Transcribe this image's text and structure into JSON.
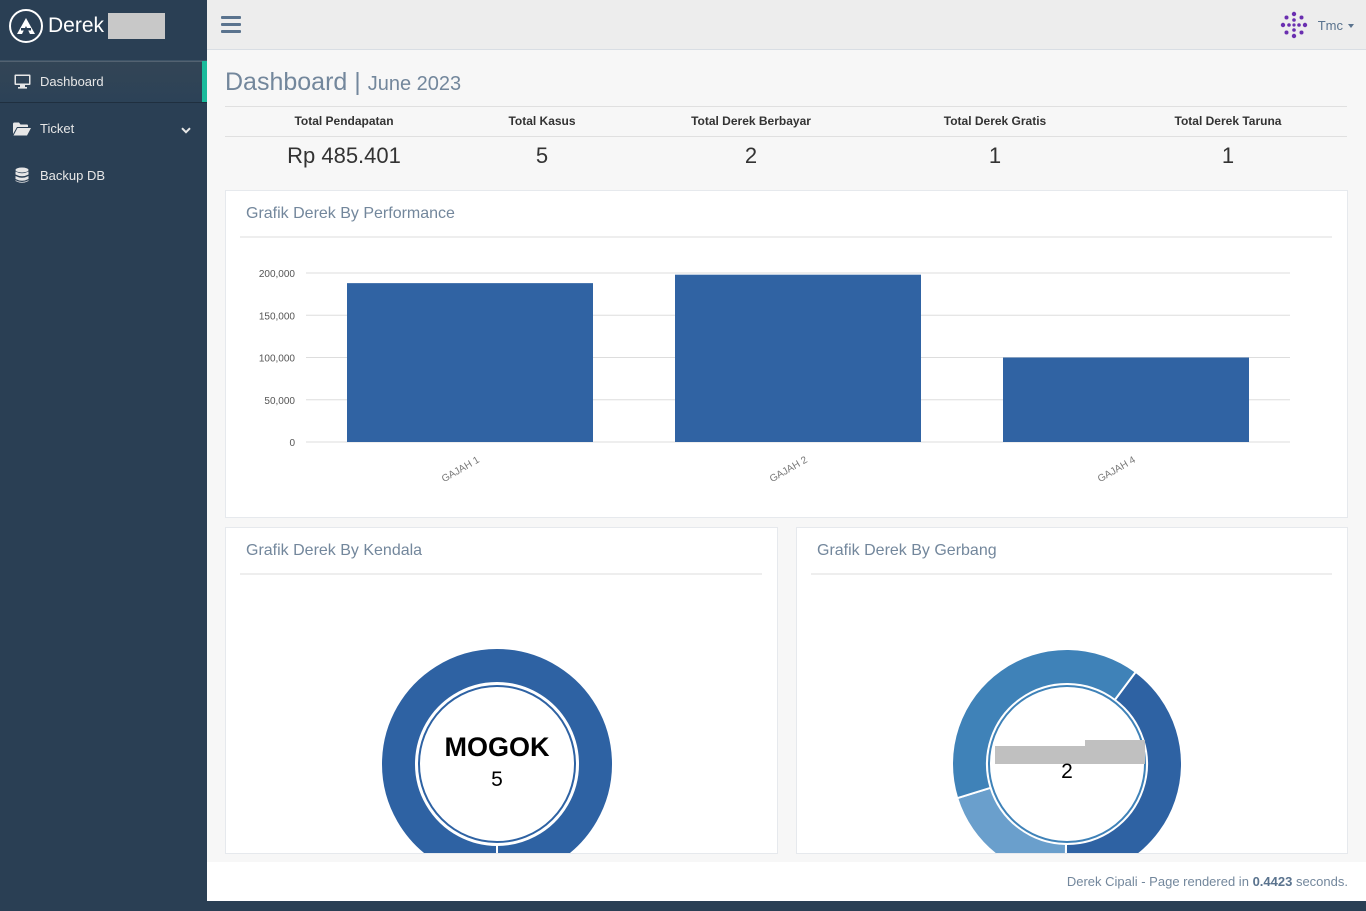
{
  "brand": {
    "title": "Derek"
  },
  "sidebar": {
    "items": [
      {
        "label": "Dashboard",
        "icon": "monitor-icon"
      },
      {
        "label": "Ticket",
        "icon": "folder-open-icon"
      },
      {
        "label": "Backup DB",
        "icon": "database-icon"
      }
    ]
  },
  "topbar": {
    "user_name": "Tmc"
  },
  "page": {
    "title": "Dashboard",
    "separator": "|",
    "subtitle": "June 2023"
  },
  "stats": [
    {
      "label": "Total Pendapatan",
      "value": "Rp 485.401"
    },
    {
      "label": "Total Kasus",
      "value": "5"
    },
    {
      "label": "Total Derek Berbayar",
      "value": "2"
    },
    {
      "label": "Total Derek Gratis",
      "value": "1"
    },
    {
      "label": "Total Derek Taruna",
      "value": "1"
    }
  ],
  "panels": {
    "performance_title": "Grafik Derek By Performance",
    "kendala_title": "Grafik Derek By Kendala",
    "gerbang_title": "Grafik Derek By Gerbang"
  },
  "colors": {
    "sidebar": "#2a3f54",
    "accent": "#1abb9c",
    "bar": "#3063a3",
    "donut_dark": "#2e62a3",
    "donut_mid": "#3f82b8",
    "donut_light": "#6a9fcc"
  },
  "chart_data": [
    {
      "type": "bar",
      "categories": [
        "GAJAH 1",
        "GAJAH 2",
        "GAJAH 4"
      ],
      "values": [
        188000,
        198000,
        100000
      ],
      "ylim": [
        0,
        200000
      ],
      "yticks": [
        "200,000",
        "150,000",
        "100,000",
        "50,000",
        "0"
      ],
      "grid": true
    },
    {
      "type": "pie",
      "labels": [
        "MOGOK"
      ],
      "values": [
        5
      ],
      "center_label": "MOGOK",
      "center_value": "5"
    },
    {
      "type": "pie",
      "values": [
        2,
        1,
        2
      ],
      "center_value": "2"
    }
  ],
  "footer": {
    "text_prefix": "Derek Cipali - Page rendered in",
    "time": "0.4423",
    "text_suffix": "seconds."
  }
}
